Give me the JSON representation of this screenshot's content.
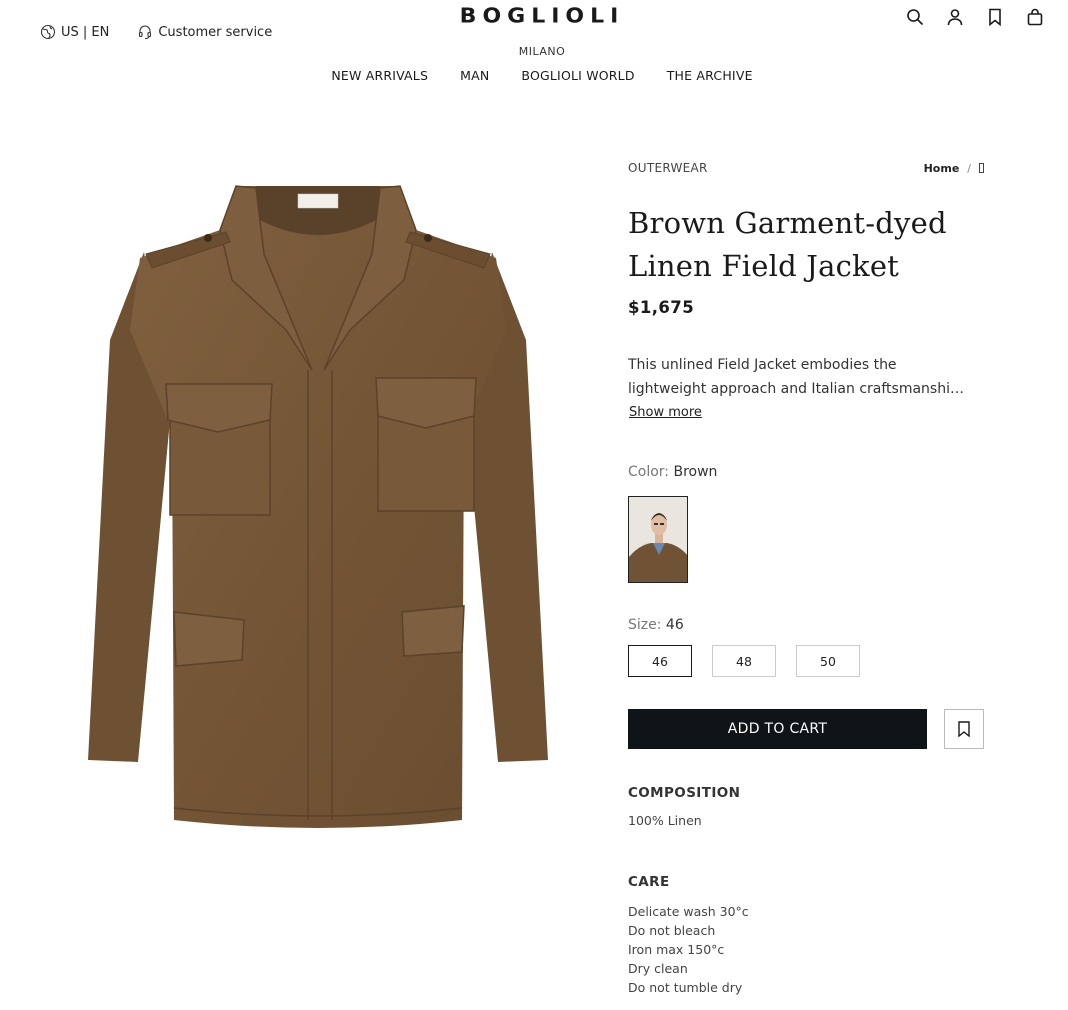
{
  "header": {
    "locale": "US | EN",
    "customer_service": "Customer service",
    "logo": "BOGLIOLI",
    "logo_sub": "MILANO",
    "icons": [
      "search-icon",
      "account-icon",
      "wishlist-icon",
      "bag-icon"
    ]
  },
  "nav": {
    "items": [
      "NEW ARRIVALS",
      "MAN",
      "BOGLIOLI WORLD",
      "THE ARCHIVE"
    ]
  },
  "product": {
    "category": "OUTERWEAR",
    "breadcrumb": {
      "home": "Home",
      "separator": "/"
    },
    "title_line1": "Brown Garment-dyed",
    "title_line2": "Linen Field Jacket",
    "price": "$1,675",
    "description": "This unlined Field Jacket embodies the lightweight approach and Italian craftsmanship",
    "description_line1": "This unlined Field Jacket embodies the",
    "description_line2": "lightweight approach and Italian craftsmanshi…",
    "show_more": "Show more",
    "color_label": "Color:",
    "color_value": "Brown",
    "size_label": "Size:",
    "size_value": "46",
    "sizes": [
      "46",
      "48",
      "50"
    ],
    "selected_size": "46",
    "add_to_cart": "ADD TO CART",
    "composition_title": "COMPOSITION",
    "composition": "100% Linen",
    "care_title": "CARE",
    "care": [
      "Delicate wash 30°c",
      "Do not bleach",
      "Iron max 150°c",
      "Dry clean",
      "Do not tumble dry"
    ]
  },
  "colors": {
    "jacket": "#7a5a3c",
    "jacket_dark": "#5e432b",
    "button_bg": "#0e1418"
  }
}
